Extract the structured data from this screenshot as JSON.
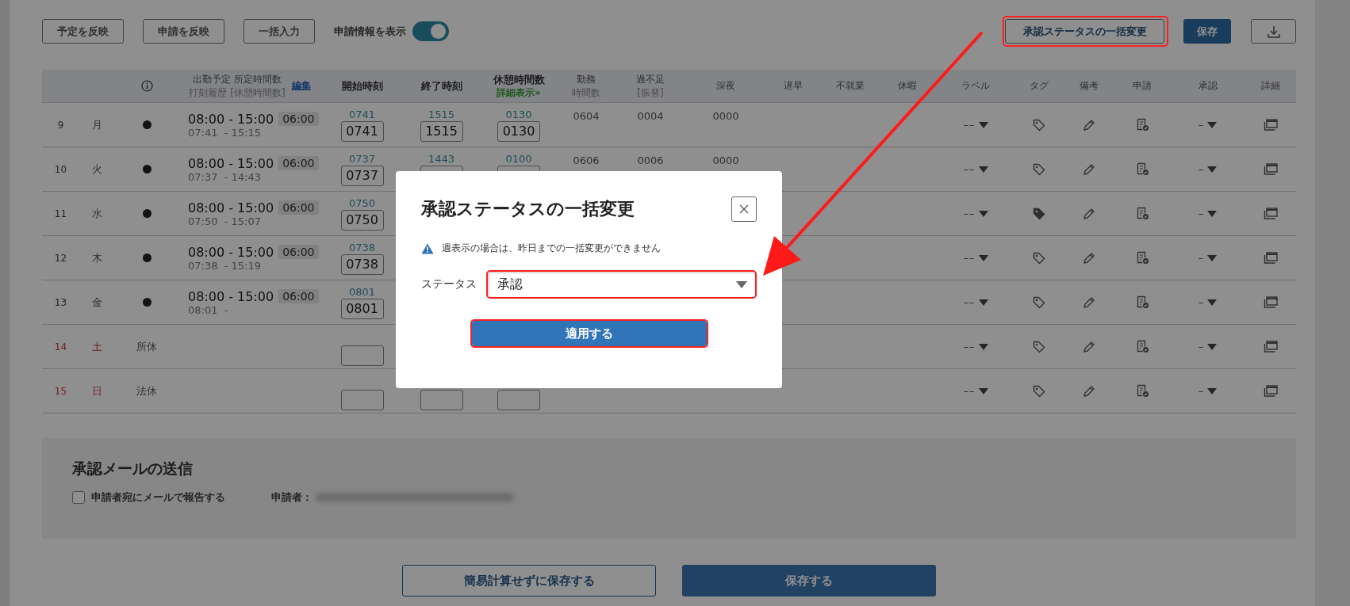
{
  "toolbar": {
    "buttons": [
      "予定を反映",
      "申請を反映",
      "一括入力"
    ],
    "toggle": {
      "label": "申請情報を表示",
      "on": true
    },
    "bulk_button": {
      "label": "承認ステータスの一括変更",
      "highlighted": true
    },
    "save_button": "保存"
  },
  "table": {
    "columns": [
      {
        "kind": "icon"
      },
      {
        "kind": "schedule",
        "label": "出勤予定 所定時間数",
        "sub": "打刻履歴 [休憩時間数]",
        "link": "編集"
      },
      {
        "kind": "text",
        "label": "開始時刻",
        "bold": true
      },
      {
        "kind": "text",
        "label": "終了時刻",
        "bold": true
      },
      {
        "kind": "text",
        "label": "休憩時間数",
        "bold": true,
        "link": "詳細表示»"
      },
      {
        "kind": "text",
        "label": "勤務",
        "sub": "時間数",
        "bold": false
      },
      {
        "kind": "text",
        "label": "過不足",
        "sub": "[振替]",
        "bold": false
      },
      {
        "kind": "text",
        "label": "深夜",
        "bold": false
      },
      {
        "kind": "text",
        "label": "遅早",
        "bold": false
      },
      {
        "kind": "text",
        "label": "不就業",
        "bold": false
      },
      {
        "kind": "text",
        "label": "休暇",
        "bold": false
      },
      {
        "kind": "text",
        "label": "ラベル",
        "bold": false
      },
      {
        "kind": "text",
        "label": "タグ",
        "bold": false
      },
      {
        "kind": "text",
        "label": "備考",
        "bold": false
      },
      {
        "kind": "text",
        "label": "申請",
        "bold": false
      },
      {
        "kind": "text",
        "label": "承認",
        "bold": false
      },
      {
        "kind": "text",
        "label": "詳細",
        "bold": false
      }
    ],
    "rows": [
      {
        "day": "9",
        "weekday": "月",
        "holiday": false,
        "kind": "workday",
        "plan": "08:00 - 15:00",
        "hours": "06:00",
        "actual": "07:41  - 15:15",
        "start": {
          "plan": "0741",
          "value": "0741"
        },
        "end": {
          "plan": "1515",
          "value": "1515"
        },
        "break": {
          "plan": "0130",
          "value": "0130"
        },
        "work": "0604",
        "over": "0004",
        "deep": "0000",
        "label": "––",
        "tagged": false,
        "approval": "–"
      },
      {
        "day": "10",
        "weekday": "火",
        "holiday": false,
        "kind": "workday",
        "plan": "08:00 - 15:00",
        "hours": "06:00",
        "actual": "07:37  - 14:43",
        "start": {
          "plan": "0737",
          "value": "0737"
        },
        "end": {
          "plan": "1443"
        },
        "break": {
          "plan": "0100"
        },
        "work": "0606",
        "over": "0006",
        "deep": "0000",
        "label": "––",
        "tagged": false,
        "approval": "–"
      },
      {
        "day": "11",
        "weekday": "水",
        "holiday": false,
        "kind": "workday",
        "plan": "08:00 - 15:00",
        "hours": "06:00",
        "actual": "07:50  - 15:07",
        "start": {
          "plan": "0750",
          "value": "0750"
        },
        "label": "––",
        "tagged": true,
        "approval": "–"
      },
      {
        "day": "12",
        "weekday": "木",
        "holiday": false,
        "kind": "workday",
        "plan": "08:00 - 15:00",
        "hours": "06:00",
        "actual": "07:38  - 15:19",
        "start": {
          "plan": "0738",
          "value": "0738"
        },
        "label": "––",
        "tagged": false,
        "approval": "–"
      },
      {
        "day": "13",
        "weekday": "金",
        "holiday": false,
        "kind": "workday",
        "plan": "08:00 - 15:00",
        "hours": "06:00",
        "actual": "08:01  -",
        "start": {
          "plan": "0801",
          "value": "0801"
        },
        "label": "––",
        "tagged": false,
        "approval": "–"
      },
      {
        "day": "14",
        "weekday": "土",
        "holiday": true,
        "kind": "dayoff",
        "dayoff": "所休",
        "start": {},
        "label": "––",
        "tagged": false,
        "approval": "–"
      },
      {
        "day": "15",
        "weekday": "日",
        "holiday": true,
        "kind": "dayoff",
        "dayoff": "法休",
        "start": {},
        "end": {},
        "break": {},
        "label": "––",
        "tagged": false,
        "approval": "–"
      }
    ]
  },
  "mail_section": {
    "title": "承認メールの送信",
    "checkbox": {
      "label": "申請者宛にメールで報告する",
      "checked": false
    },
    "applicant_label": "申請者："
  },
  "footer_buttons": [
    {
      "label": "簡易計算せずに保存する",
      "kind": "outline"
    },
    {
      "label": "保存する",
      "kind": "primary"
    }
  ],
  "dialog": {
    "title": "承認ステータスの一括変更",
    "warning": "週表示の場合は、昨日までの一括変更ができません",
    "field_label": "ステータス",
    "select": {
      "value": "承認",
      "highlighted": true
    },
    "apply_button": {
      "label": "適用する",
      "highlighted": true
    }
  },
  "annotation": {
    "arrow": true
  }
}
